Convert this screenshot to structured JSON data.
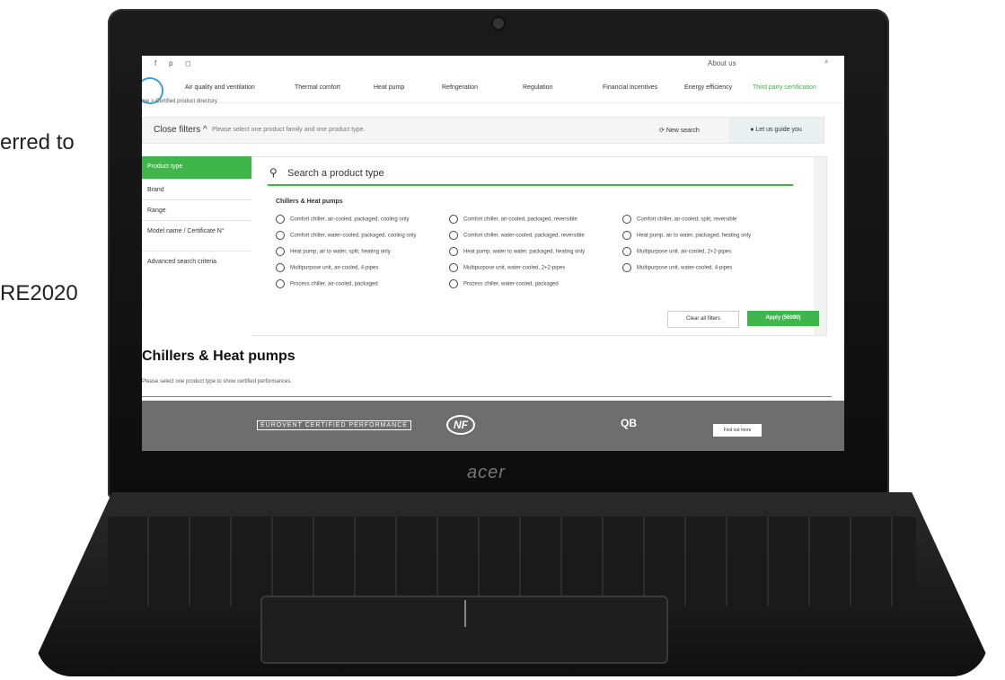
{
  "background_text": {
    "line1": "erred  to",
    "line2": "RE2020"
  },
  "laptop": {
    "brand": "acer"
  },
  "site": {
    "topbar": {
      "icons": [
        "facebook-icon",
        "pinterest-icon",
        "instagram-icon"
      ],
      "about": "About us"
    },
    "nav": {
      "logo": "eurovent lita",
      "items": [
        "Air quality and ventilation",
        "Thermal comfort",
        "Heat pump",
        "Refrigeration",
        "Regulation",
        "Financial incentives",
        "Energy efficiency",
        "Third party certification"
      ]
    },
    "breadcrumb": "me > Certified product directory",
    "filters": {
      "close_label": "Close filters ^",
      "hint": "Please select one product family and one product type.",
      "new_search": "New search",
      "guide": "Let us guide you"
    },
    "sidebar": [
      "Product type",
      "Brand",
      "Range",
      "Model name / Certificate N°",
      "Advanced search criteria"
    ],
    "search_placeholder": "Search a product type",
    "category": "Chillers & Heat pumps",
    "options": {
      "col1": [
        "Comfort chiller, air-cooled, packaged, cooling only",
        "Comfort chiller, water-cooled, packaged, cooling only",
        "Heat pump, air to water, split, heating only",
        "Multipurpose unit, air-cooled, 4-pipes",
        "Process chiller, air-cooled, packaged"
      ],
      "col2": [
        "Comfort chiller, air-cooled, packaged, reversible",
        "Comfort chiller, water-cooled, packaged, reversible",
        "Heat pump, water to water, packaged, heating only",
        "Multipurpose unit, water-cooled, 2+2-pipes",
        "Process chiller, water-cooled, packaged"
      ],
      "col3": [
        "Comfort chiller, air-cooled, split, reversible",
        "Heat pump, air to water, packaged, heating only",
        "Multipurpose unit, air-cooled, 2+2-pipes",
        "Multipurpose unit, water-cooled, 4-pipes"
      ]
    },
    "clear_all": "Clear all filters",
    "apply": "Apply (56090)",
    "section_title": "Chillers & Heat pumps",
    "section_msg": "Please select one product type to show certified performances.",
    "footer": {
      "eurovent": "EUROVENT CERTIFIED PERFORMANCE",
      "nf": "NF",
      "qb": "QB",
      "find_out": "Find out more"
    },
    "accent_color": "#3fb54a"
  }
}
